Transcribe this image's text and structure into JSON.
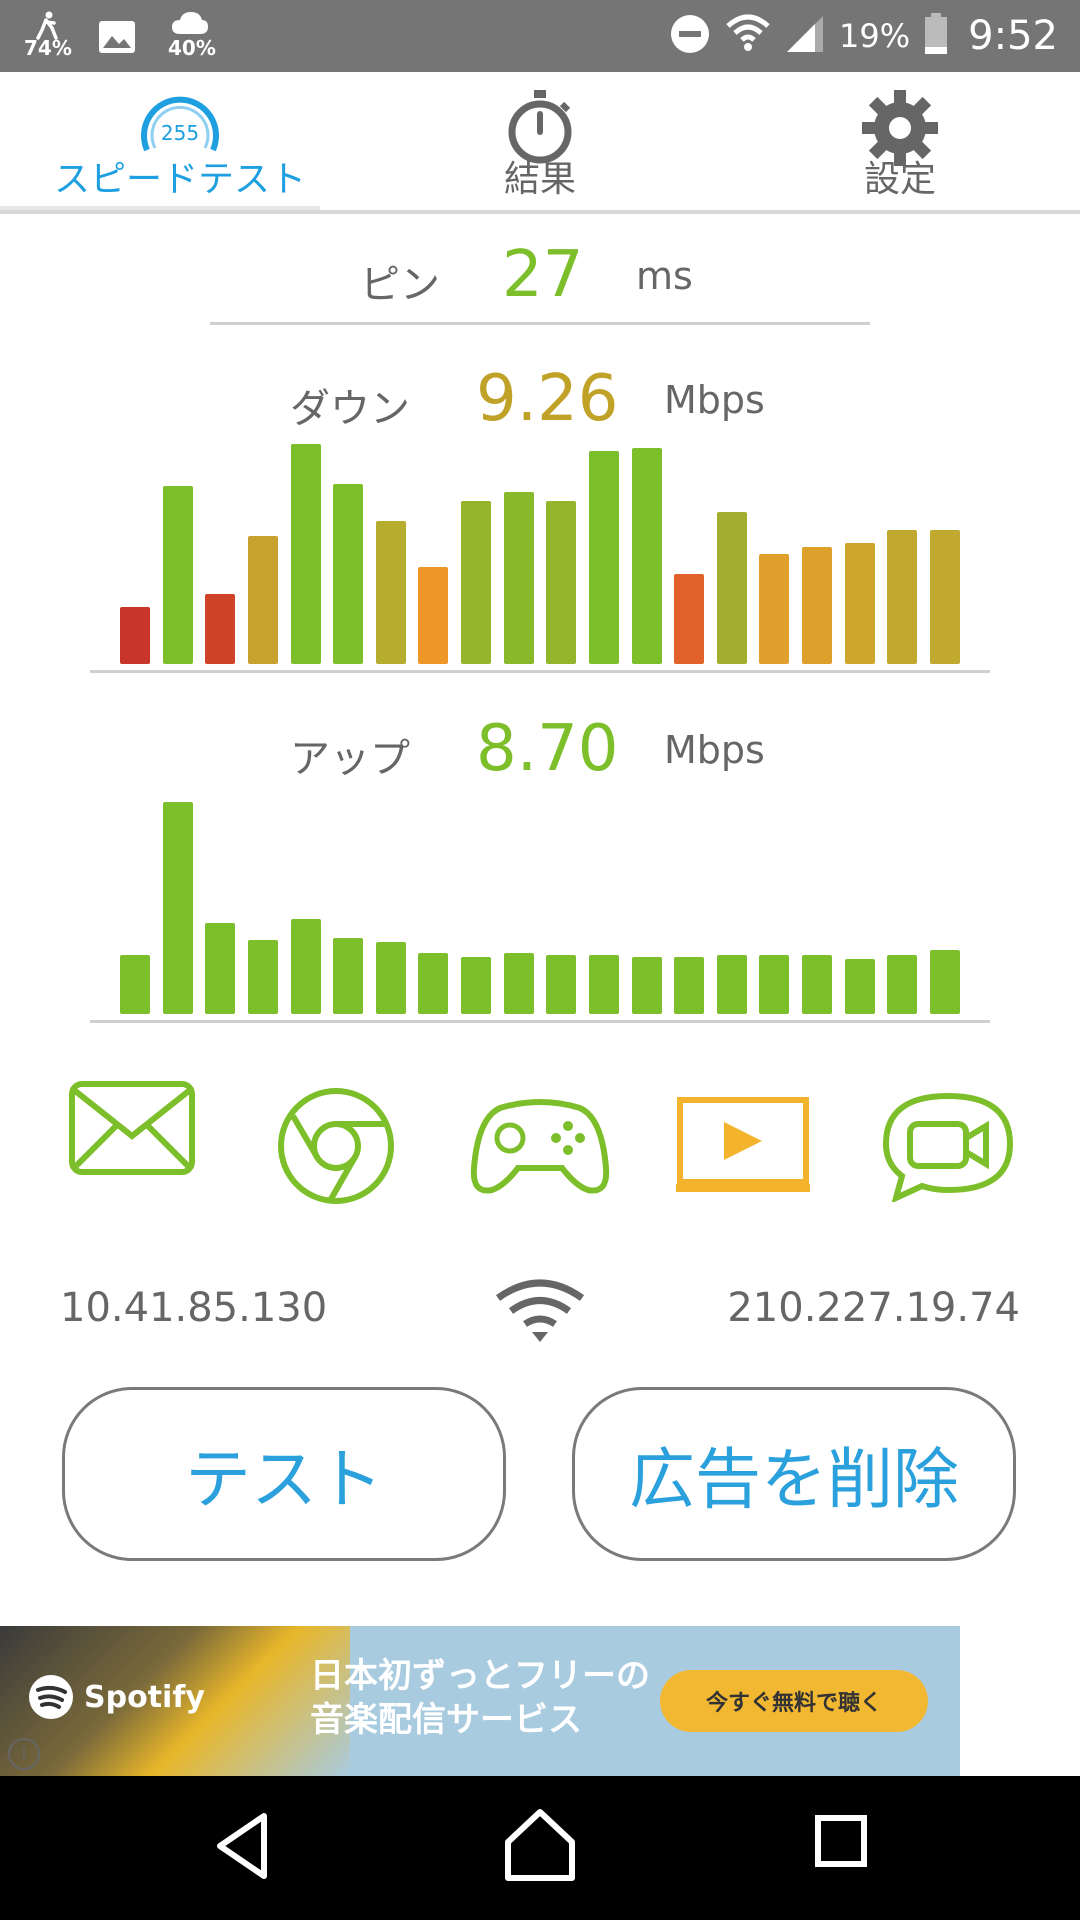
{
  "status_bar": {
    "indicators": [
      {
        "icon": "runner-icon",
        "text": "74%"
      },
      {
        "icon": "image-icon",
        "text": ""
      },
      {
        "icon": "cloud-icon",
        "text": "40%"
      }
    ],
    "battery_percent": "19%",
    "time": "9:52"
  },
  "tabs": [
    {
      "label": "スピードテスト",
      "icon": "speedometer-icon",
      "gauge_text": "255",
      "active": true
    },
    {
      "label": "結果",
      "icon": "stopwatch-icon",
      "active": false
    },
    {
      "label": "設定",
      "icon": "gear-icon",
      "active": false
    }
  ],
  "ping": {
    "label": "ピン",
    "value": "27",
    "unit": "ms",
    "color": "#7cbf2a"
  },
  "download": {
    "label": "ダウン",
    "value": "9.26",
    "unit": "Mbps",
    "color": "#c1a229",
    "bars": [
      {
        "level": 0.26,
        "color": "#c8352a"
      },
      {
        "level": 0.81,
        "color": "#7cbf2a"
      },
      {
        "level": 0.32,
        "color": "#cf4329"
      },
      {
        "level": 0.58,
        "color": "#c7a22f"
      },
      {
        "level": 1.0,
        "color": "#7cbf2a"
      },
      {
        "level": 0.82,
        "color": "#7cbf2a"
      },
      {
        "level": 0.65,
        "color": "#b6ad2e"
      },
      {
        "level": 0.44,
        "color": "#ef9628"
      },
      {
        "level": 0.74,
        "color": "#92b52b"
      },
      {
        "level": 0.78,
        "color": "#88b92b"
      },
      {
        "level": 0.74,
        "color": "#92b52b"
      },
      {
        "level": 0.97,
        "color": "#7cbf2a"
      },
      {
        "level": 0.98,
        "color": "#7cbf2a"
      },
      {
        "level": 0.41,
        "color": "#e2602a"
      },
      {
        "level": 0.69,
        "color": "#a4ad2d"
      },
      {
        "level": 0.5,
        "color": "#e0a02b"
      },
      {
        "level": 0.53,
        "color": "#dca02b"
      },
      {
        "level": 0.55,
        "color": "#cfa62c"
      },
      {
        "level": 0.61,
        "color": "#c1a82e"
      },
      {
        "level": 0.61,
        "color": "#c1a82e"
      }
    ]
  },
  "upload": {
    "label": "アップ",
    "value": "8.70",
    "unit": "Mbps",
    "color": "#7cbf2a",
    "bars": [
      0.28,
      1.0,
      0.43,
      0.35,
      0.45,
      0.36,
      0.34,
      0.29,
      0.27,
      0.29,
      0.28,
      0.28,
      0.27,
      0.27,
      0.28,
      0.28,
      0.28,
      0.26,
      0.28,
      0.3
    ],
    "bar_color": "#7cbf2a"
  },
  "apps": [
    {
      "icon": "mail-icon",
      "color": "#7cbf2a"
    },
    {
      "icon": "chrome-icon",
      "color": "#7cbf2a"
    },
    {
      "icon": "gamepad-icon",
      "color": "#7cbf2a"
    },
    {
      "icon": "video-play-icon",
      "color": "#f4b32d"
    },
    {
      "icon": "video-chat-icon",
      "color": "#7cbf2a"
    }
  ],
  "network": {
    "local_ip": "10.41.85.130",
    "external_ip": "210.227.19.74"
  },
  "buttons": {
    "test": "テスト",
    "remove_ads": "広告を削除"
  },
  "ad": {
    "brand": "Spotify",
    "line1": "日本初ずっとフリーの",
    "line2": "音楽配信サービス",
    "cta": "今すぐ無料で聴く",
    "info": "i"
  },
  "colors": {
    "accent": "#1e9fe0",
    "green": "#7cbf2a",
    "gold": "#c1a229",
    "orange": "#f4b32d"
  }
}
